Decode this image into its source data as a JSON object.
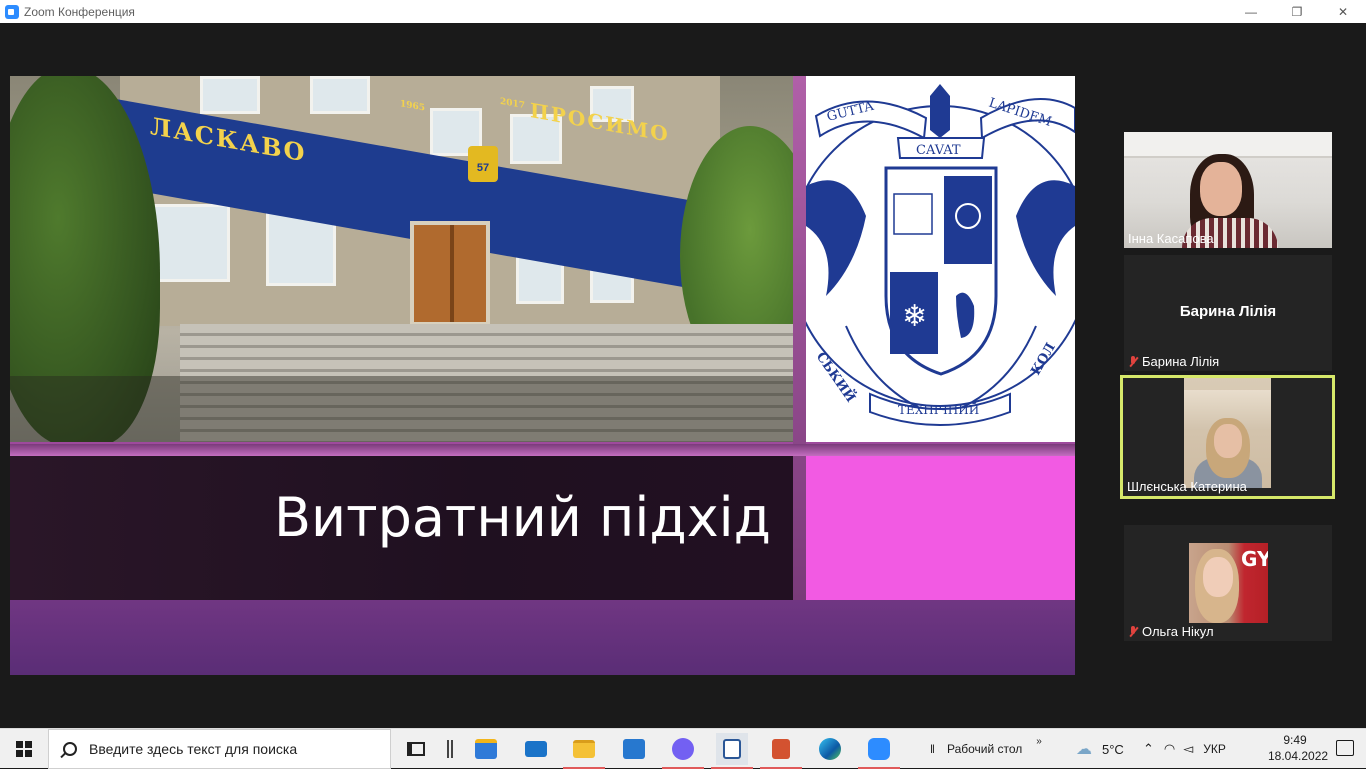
{
  "window": {
    "title": "Zoom Конференция",
    "controls": {
      "minimize": "—",
      "restore": "❐",
      "close": "✕"
    }
  },
  "slide": {
    "title": "Витратний підхід",
    "banner_left": "ЛАСКАВО",
    "banner_right": "ПРОСИМО",
    "banner_year_left": "1965",
    "banner_year_right": "2017",
    "badge": "57",
    "logo": {
      "ribbon_left": "GUTTA",
      "ribbon_right": "LAPIDEM",
      "ribbon_center": "CAVAT",
      "arc_left": "СЬКИЙ",
      "arc_right": "КОЛ",
      "arc_bottom": "ТЕХНІЧНИЙ"
    },
    "colors": {
      "pink": "#f25ae3",
      "dark": "#221022",
      "logo_blue": "#1f3a93"
    }
  },
  "participants": [
    {
      "name": "Інна Касапова",
      "muted": false,
      "video": true,
      "active": false
    },
    {
      "name": "Барина Лілія",
      "center_label": "Барина Лілія",
      "muted": true,
      "video": false,
      "active": false
    },
    {
      "name": "Шлєнська Катерина",
      "muted": false,
      "video": true,
      "active": true
    },
    {
      "name": "Ольга Нікул",
      "muted": true,
      "video": true,
      "active": false,
      "background_text": "GY"
    }
  ],
  "taskbar": {
    "search_placeholder": "Введите здесь текст для поиска",
    "toolbar_label": "Рабочий стол",
    "toolbar_chevron": "»",
    "weather": "5°C",
    "language": "УКР",
    "time": "9:49",
    "date": "18.04.2022",
    "apps": [
      "task-view",
      "widgets-divider",
      "microsoft-store",
      "mail",
      "file-explorer",
      "photos",
      "viber",
      "document-app",
      "presentation-app",
      "edge",
      "zoom"
    ]
  }
}
